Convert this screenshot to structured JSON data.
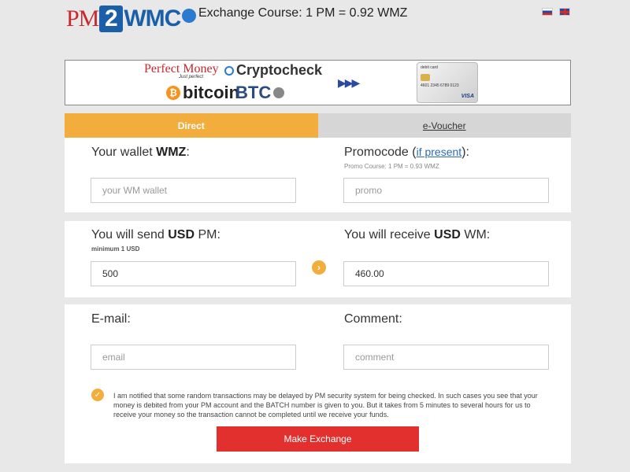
{
  "header": {
    "logo": {
      "pm": "PM",
      "two": "2",
      "wmc": "WMC"
    },
    "course": "Exchange Course: 1 PM = 0.92 WMZ",
    "flags": [
      "ru",
      "en"
    ]
  },
  "banner": {
    "perfect_money": "Perfect Money",
    "perfect_money_sub": "Just perfect",
    "cryptocheck": "Cryptocheck",
    "bitcoin": "bitcoin",
    "btce": "BTC",
    "arrows": "▶▶▶",
    "card": {
      "title": "debit card",
      "number": "4601 2345 6789 0123",
      "brand": "VISA"
    }
  },
  "tabs": [
    {
      "label": "Direct",
      "active": true
    },
    {
      "label": "e-Voucher",
      "active": false
    }
  ],
  "wallet": {
    "label_pre": "Your wallet ",
    "label_bold": "WMZ",
    "label_post": ":",
    "placeholder": "your WM wallet",
    "value": ""
  },
  "promo": {
    "label_pre": "Promocode (",
    "link": "if present",
    "label_post": "):",
    "course": "Promo Course: 1 PM = 0.93 WMZ",
    "placeholder": "promo",
    "value": ""
  },
  "send": {
    "label_pre": "You will send ",
    "label_bold": "USD",
    "label_post": " PM:",
    "min": "minimum 1 USD",
    "value": "500"
  },
  "receive": {
    "label_pre": "You will receive ",
    "label_bold": "USD",
    "label_post": " WM:",
    "value": "460.00"
  },
  "email": {
    "label": "E-mail:",
    "placeholder": "email",
    "value": ""
  },
  "comment": {
    "label": "Comment:",
    "placeholder": "comment",
    "value": ""
  },
  "agreement": {
    "checked": true,
    "text": "I am notified that some random transactions may be delayed by PM security system for being checked. In such cases you see that your money is debited from your PM account and the BATCH number is given to you. But it takes from 5 minutes to several hours for us to receive your money so the transaction cannot be completed until we receive your funds."
  },
  "submit_label": "Make Exchange",
  "colors": {
    "accent": "#f2ad3c",
    "submit": "#e2302f",
    "link": "#2a6ab8",
    "logo_red": "#c9282d",
    "logo_blue": "#1a5fa8"
  }
}
